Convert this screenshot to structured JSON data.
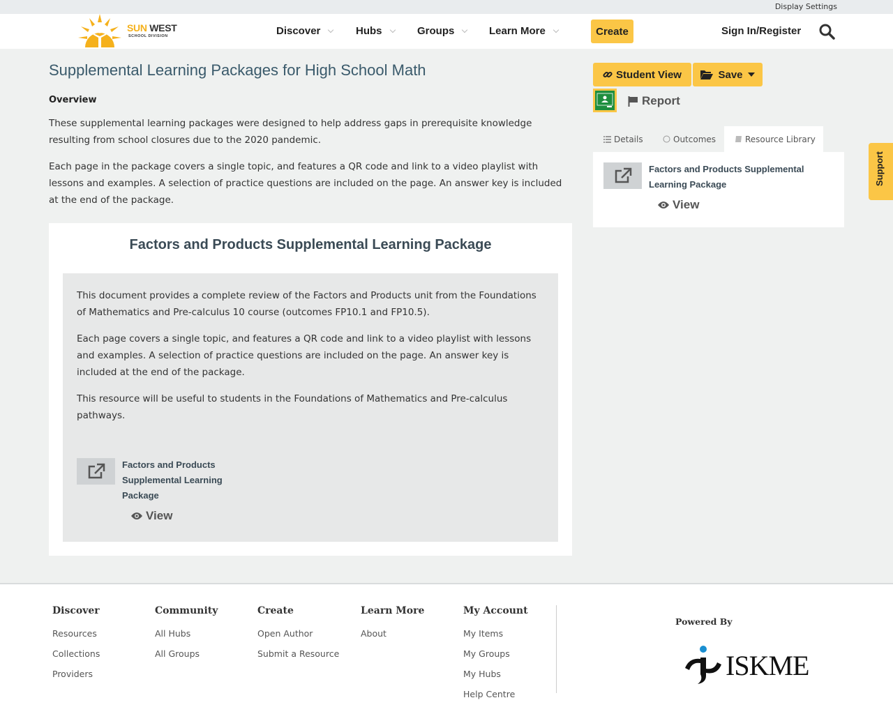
{
  "topbar": {
    "display_settings": "Display Settings"
  },
  "header": {
    "logo_title_a": "SUN",
    "logo_title_b": "WEST",
    "logo_sub": "SCHOOL DIVISION",
    "nav": [
      "Discover",
      "Hubs",
      "Groups",
      "Learn More"
    ],
    "create": "Create",
    "signin": "Sign In/Register"
  },
  "main": {
    "title": "Supplemental Learning Packages for High School Math",
    "overview_heading": "Overview",
    "overview_p1": "These supplemental learning packages were designed to help address gaps in prerequisite knowledge resulting from school closures due to the 2020 pandemic.",
    "overview_p2": "Each page in the package covers a single topic, and features a QR code and link to a video playlist with lessons and examples. A selection of practice questions are included on the page. An answer key is included at the end of the package.",
    "card": {
      "title": "Factors and Products Supplemental Learning Package",
      "p1": "This document provides a complete review of the Factors and Products unit from the Foundations of Mathematics and Pre-calculus 10 course (outcomes FP10.1 and FP10.5).",
      "p2": "Each page covers a single topic, and features a QR code and link to a video playlist with lessons and examples. A selection of practice questions are included on the page. An answer key is included at the end of the package.",
      "p3": "This resource will be useful to students in the Foundations of Mathematics and Pre-calculus pathways.",
      "resource_title": "Factors and Products Supplemental Learning Package",
      "view": "View"
    }
  },
  "sidebar": {
    "student_view": "Student View",
    "save": "Save",
    "report": "Report",
    "tabs": [
      "Details",
      "Outcomes",
      "Resource Library"
    ],
    "resource_title": "Factors and Products Supplemental Learning Package",
    "view": "View"
  },
  "support": "Support",
  "footer": {
    "cols": [
      {
        "heading": "Discover",
        "links": [
          "Resources",
          "Collections",
          "Providers"
        ]
      },
      {
        "heading": "Community",
        "links": [
          "All Hubs",
          "All Groups"
        ]
      },
      {
        "heading": "Create",
        "links": [
          "Open Author",
          "Submit a Resource"
        ]
      },
      {
        "heading": "Learn More",
        "links": [
          "About"
        ]
      },
      {
        "heading": "My Account",
        "links": [
          "My Items",
          "My Groups",
          "My Hubs",
          "Help Centre"
        ]
      }
    ],
    "powered_by": "Powered By",
    "iskme": "ISKME"
  },
  "colors": {
    "accent": "#fbc646",
    "title": "#3a5a6b",
    "background": "#eff1f0"
  }
}
